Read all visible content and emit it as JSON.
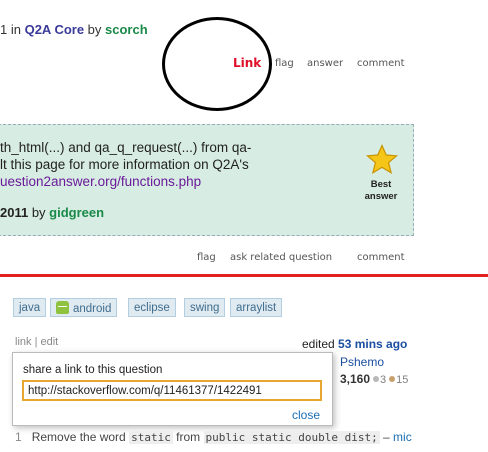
{
  "q2a": {
    "meta": {
      "prefix": "1 in ",
      "category": "Q2A Core",
      "by": " by ",
      "user": "scorch"
    },
    "actions": {
      "link": "Link",
      "flag": "flag",
      "answer": "answer",
      "comment": "comment"
    },
    "answer": {
      "lines": [
        "th_html(...) and qa_q_request(...) from qa-",
        "lt this page for more information on Q2A's",
        "uestion2answer.org/functions.php"
      ],
      "year": "2011",
      "by": " by ",
      "user": "gidgreen",
      "best_label": "Best answer"
    },
    "answer_actions": {
      "flag": "flag",
      "ask_related": "ask related question",
      "comment": "comment"
    }
  },
  "so": {
    "tags": [
      "java",
      "android",
      "eclipse",
      "swing",
      "arraylist"
    ],
    "post_menu": {
      "link": "link",
      "sep": " | ",
      "edit": "edit"
    },
    "edited": {
      "label": "edited ",
      "ago": "53 mins ago"
    },
    "user": {
      "name": "Pshemo",
      "rep": "3,160",
      "silver": "3",
      "bronze": "15"
    },
    "share": {
      "title": "share a link to this question",
      "url": "http://stackoverflow.com/q/11461377/1422491",
      "close": "close"
    },
    "comment": {
      "votes": "1",
      "pre": "Remove the word ",
      "code1": "static",
      "mid": " from ",
      "code2": "public static double dist;",
      "post": " – ",
      "author": "mic"
    }
  },
  "colors": {
    "red_line": "#e32020",
    "link_red": "#e0102a",
    "answer_bg": "#d7ece2",
    "tag_bg": "#e0eaf1",
    "input_border": "#e8a530",
    "silver": "#b8b8b8",
    "bronze": "#c8a070"
  }
}
